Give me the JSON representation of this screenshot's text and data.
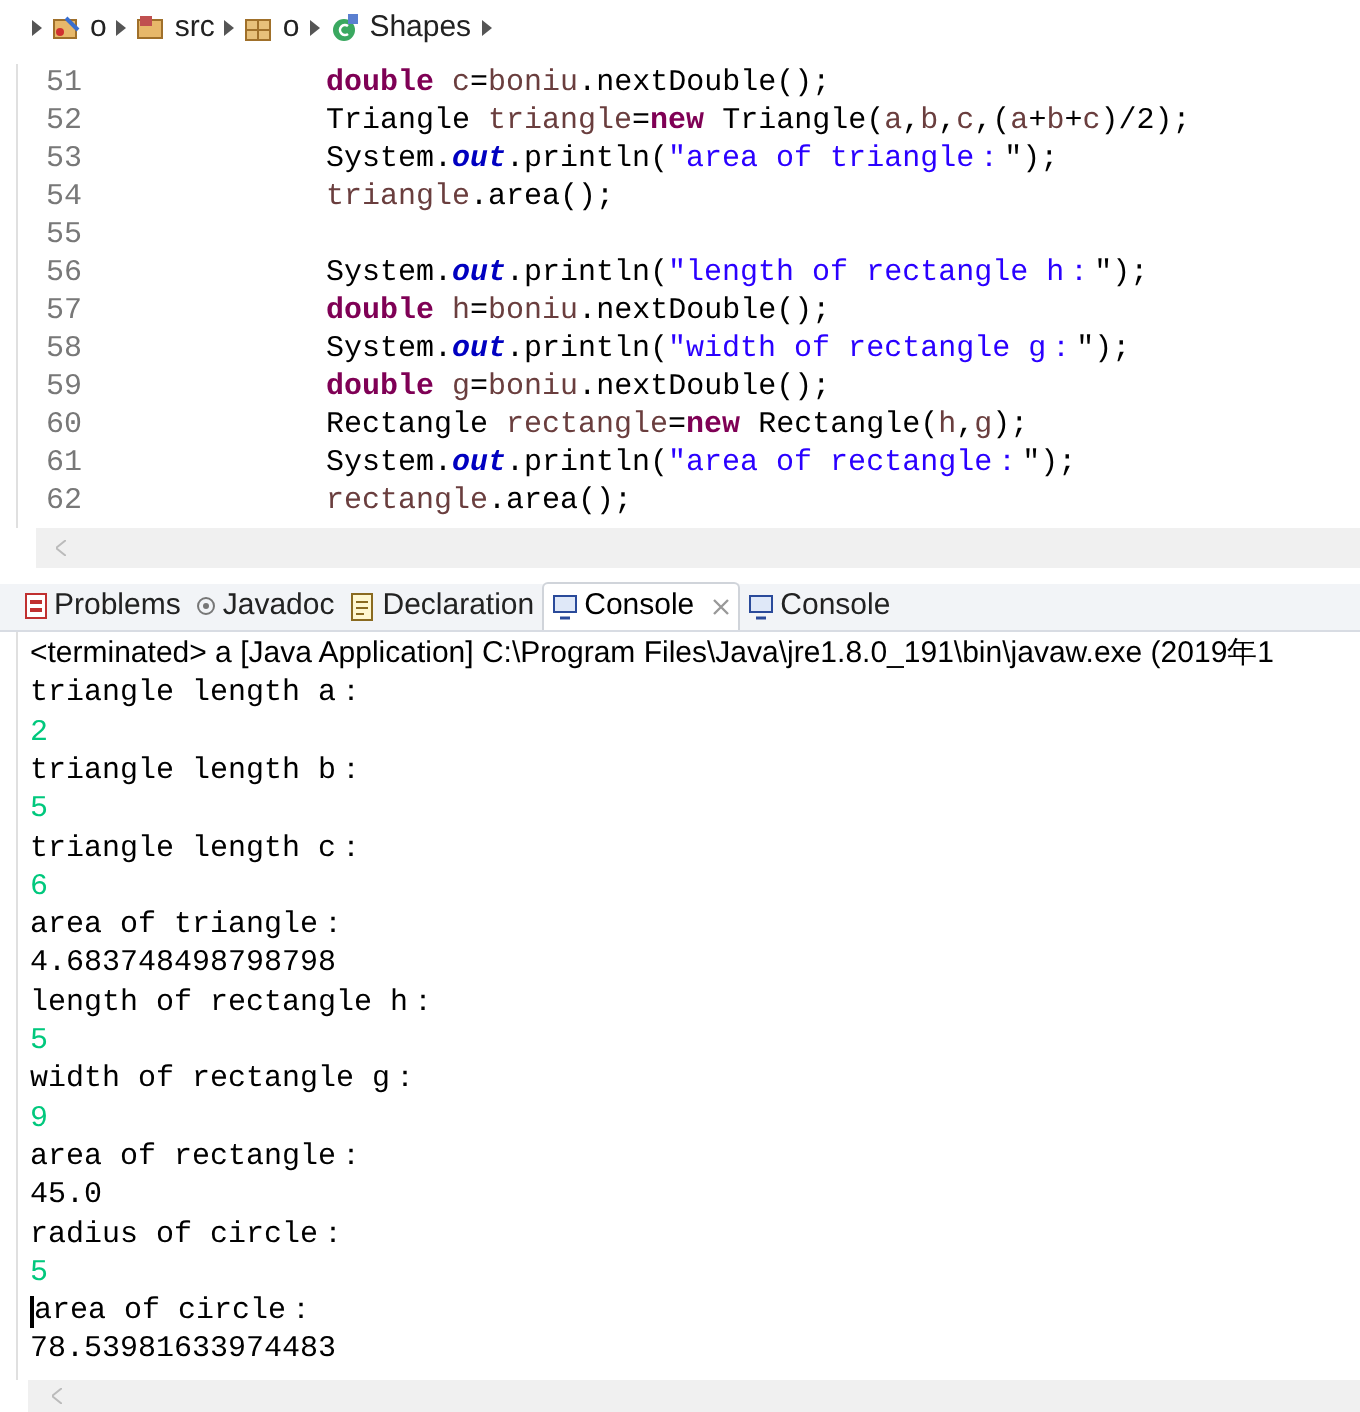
{
  "breadcrumb": [
    {
      "label": "o",
      "kind": "project"
    },
    {
      "label": "src",
      "kind": "source"
    },
    {
      "label": "o",
      "kind": "package"
    },
    {
      "label": "Shapes",
      "kind": "class"
    }
  ],
  "editor": {
    "lines": [
      {
        "number": "51",
        "tokens": [
          {
            "kind": "keyword",
            "text": "double "
          },
          {
            "kind": "var",
            "text": "c"
          },
          {
            "kind": "plain",
            "text": "="
          },
          {
            "kind": "var",
            "text": "boniu"
          },
          {
            "kind": "plain",
            "text": ".nextDouble();"
          }
        ]
      },
      {
        "number": "52",
        "tokens": [
          {
            "kind": "plain",
            "text": "Triangle "
          },
          {
            "kind": "var",
            "text": "triangle"
          },
          {
            "kind": "plain",
            "text": "="
          },
          {
            "kind": "keyword",
            "text": "new"
          },
          {
            "kind": "plain",
            "text": " Triangle("
          },
          {
            "kind": "var",
            "text": "a"
          },
          {
            "kind": "plain",
            "text": ","
          },
          {
            "kind": "var",
            "text": "b"
          },
          {
            "kind": "plain",
            "text": ","
          },
          {
            "kind": "var",
            "text": "c"
          },
          {
            "kind": "plain",
            "text": ",("
          },
          {
            "kind": "var",
            "text": "a"
          },
          {
            "kind": "plain",
            "text": "+"
          },
          {
            "kind": "var",
            "text": "b"
          },
          {
            "kind": "plain",
            "text": "+"
          },
          {
            "kind": "var",
            "text": "c"
          },
          {
            "kind": "plain",
            "text": ")/2);"
          }
        ]
      },
      {
        "number": "53",
        "tokens": [
          {
            "kind": "plain",
            "text": "System."
          },
          {
            "kind": "field",
            "text": "out"
          },
          {
            "kind": "plain",
            "text": ".println("
          },
          {
            "kind": "string",
            "text": "\"area of triangle："
          },
          {
            "kind": "plain",
            "text": "\");"
          }
        ]
      },
      {
        "number": "54",
        "tokens": [
          {
            "kind": "var",
            "text": "triangle"
          },
          {
            "kind": "plain",
            "text": ".area();"
          }
        ]
      },
      {
        "number": "55"
      },
      {
        "number": "56",
        "tokens": [
          {
            "kind": "plain",
            "text": "System."
          },
          {
            "kind": "field",
            "text": "out"
          },
          {
            "kind": "plain",
            "text": ".println("
          },
          {
            "kind": "string",
            "text": "\"length of rectangle h："
          },
          {
            "kind": "plain",
            "text": "\");"
          }
        ]
      },
      {
        "number": "57",
        "tokens": [
          {
            "kind": "keyword",
            "text": "double "
          },
          {
            "kind": "var",
            "text": "h"
          },
          {
            "kind": "plain",
            "text": "="
          },
          {
            "kind": "var",
            "text": "boniu"
          },
          {
            "kind": "plain",
            "text": ".nextDouble();"
          }
        ]
      },
      {
        "number": "58",
        "tokens": [
          {
            "kind": "plain",
            "text": "System."
          },
          {
            "kind": "field",
            "text": "out"
          },
          {
            "kind": "plain",
            "text": ".println("
          },
          {
            "kind": "string",
            "text": "\"width of rectangle g："
          },
          {
            "kind": "plain",
            "text": "\");"
          }
        ]
      },
      {
        "number": "59",
        "tokens": [
          {
            "kind": "keyword",
            "text": "double "
          },
          {
            "kind": "var",
            "text": "g"
          },
          {
            "kind": "plain",
            "text": "="
          },
          {
            "kind": "var",
            "text": "boniu"
          },
          {
            "kind": "plain",
            "text": ".nextDouble();"
          }
        ]
      },
      {
        "number": "60",
        "tokens": [
          {
            "kind": "plain",
            "text": "Rectangle "
          },
          {
            "kind": "var",
            "text": "rectangle"
          },
          {
            "kind": "plain",
            "text": "="
          },
          {
            "kind": "keyword",
            "text": "new"
          },
          {
            "kind": "plain",
            "text": " Rectangle("
          },
          {
            "kind": "var",
            "text": "h"
          },
          {
            "kind": "plain",
            "text": ","
          },
          {
            "kind": "var",
            "text": "g"
          },
          {
            "kind": "plain",
            "text": ");"
          }
        ]
      },
      {
        "number": "61",
        "tokens": [
          {
            "kind": "plain",
            "text": "System."
          },
          {
            "kind": "field",
            "text": "out"
          },
          {
            "kind": "plain",
            "text": ".println("
          },
          {
            "kind": "string",
            "text": "\"area of rectangle："
          },
          {
            "kind": "plain",
            "text": "\");"
          }
        ]
      },
      {
        "number": "62",
        "tokens": [
          {
            "kind": "var",
            "text": "rectangle"
          },
          {
            "kind": "plain",
            "text": ".area();"
          }
        ]
      }
    ]
  },
  "tabs": [
    {
      "label": "Problems",
      "kind": "problems",
      "selected": false,
      "closable": false
    },
    {
      "label": "Javadoc",
      "kind": "javadoc",
      "selected": false,
      "closable": false
    },
    {
      "label": "Declaration",
      "kind": "declaration",
      "selected": false,
      "closable": false
    },
    {
      "label": "Console",
      "kind": "console",
      "selected": true,
      "closable": true
    },
    {
      "label": "Console",
      "kind": "console",
      "selected": false,
      "closable": false
    }
  ],
  "console": {
    "header": "<terminated> a [Java Application] C:\\Program Files\\Java\\jre1.8.0_191\\bin\\javaw.exe (2019年1",
    "lines": [
      {
        "text": "triangle length a：",
        "kind": "output",
        "cursor": false
      },
      {
        "text": "2",
        "kind": "input",
        "cursor": false
      },
      {
        "text": "triangle length b：",
        "kind": "output",
        "cursor": false
      },
      {
        "text": "5",
        "kind": "input",
        "cursor": false
      },
      {
        "text": "triangle length c：",
        "kind": "output",
        "cursor": false
      },
      {
        "text": "6",
        "kind": "input",
        "cursor": false
      },
      {
        "text": "area of triangle：",
        "kind": "output",
        "cursor": false
      },
      {
        "text": "4.683748498798798",
        "kind": "output",
        "cursor": false
      },
      {
        "text": "length of rectangle h：",
        "kind": "output",
        "cursor": false
      },
      {
        "text": "5",
        "kind": "input",
        "cursor": false
      },
      {
        "text": "width of rectangle g：",
        "kind": "output",
        "cursor": false
      },
      {
        "text": "9",
        "kind": "input",
        "cursor": false
      },
      {
        "text": "area of rectangle：",
        "kind": "output",
        "cursor": false
      },
      {
        "text": "45.0",
        "kind": "output",
        "cursor": false
      },
      {
        "text": "radius of circle：",
        "kind": "output",
        "cursor": false
      },
      {
        "text": "5",
        "kind": "input",
        "cursor": false
      },
      {
        "text": "area of circle：",
        "kind": "output",
        "cursor": true
      },
      {
        "text": "78.53981633974483",
        "kind": "output",
        "cursor": false
      }
    ]
  }
}
